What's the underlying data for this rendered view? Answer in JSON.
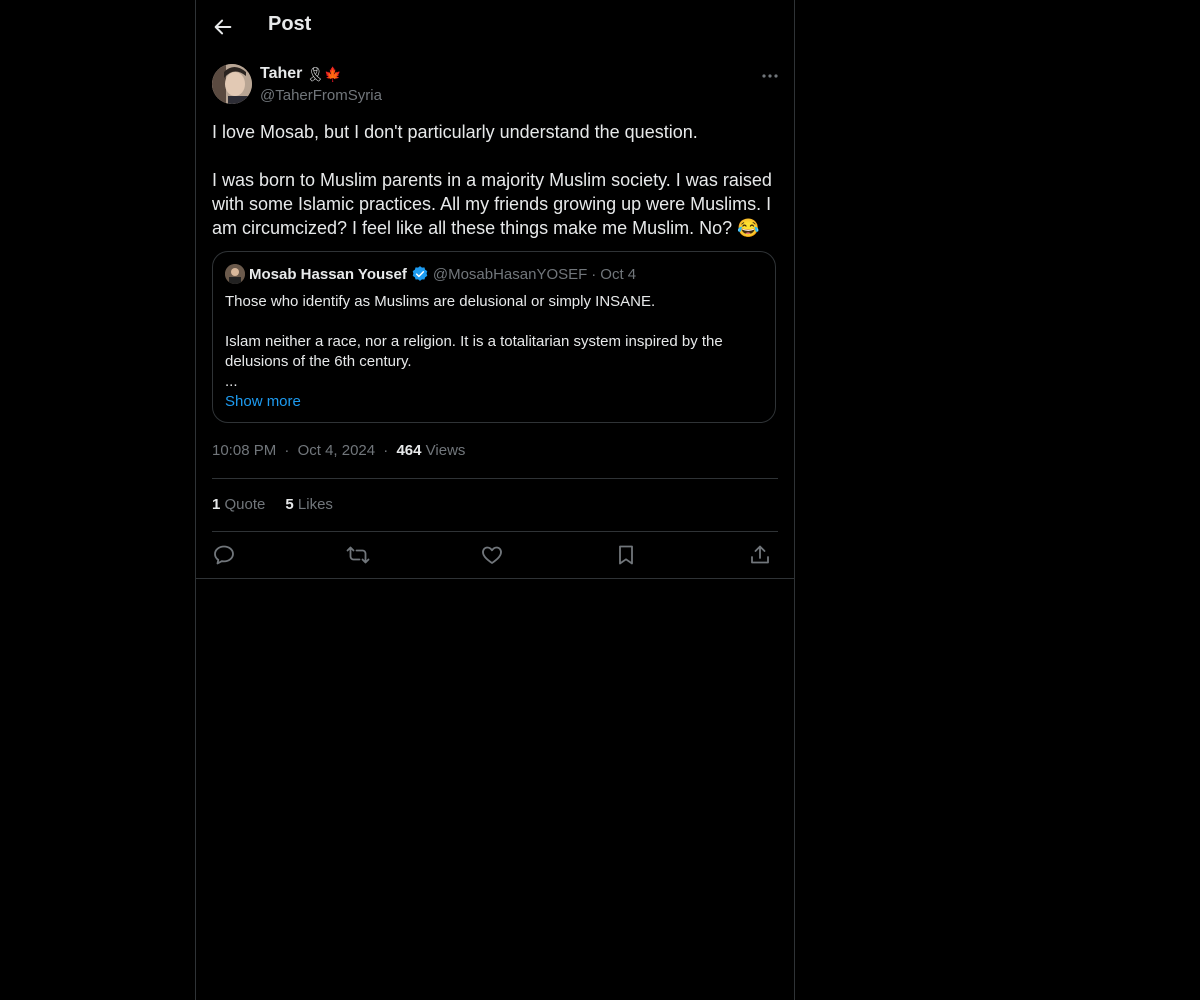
{
  "header": {
    "title": "Post"
  },
  "post": {
    "author_name": "Taher",
    "author_badges": "🎗🍁",
    "author_handle": "@TaherFromSyria",
    "text": "I love Mosab, but I don't particularly understand the question.\n\nI was born to Muslim parents in a majority Muslim society. I was raised with some Islamic practices. All my friends growing up were Muslims. I am circumcized? I feel like all these things make me Muslim. No? 😂",
    "quote": {
      "author_name": "Mosab Hassan Yousef",
      "author_handle": "@MosabHasanYOSEF",
      "separator": "·",
      "date": "Oct 4",
      "text": "Those who identify as Muslims are delusional or simply INSANE.\n\nIslam neither a race, nor a religion. It is a totalitarian system inspired by the delusions of the 6th century.\n...",
      "show_more": "Show more"
    },
    "time": "10:08 PM",
    "date": "Oct 4, 2024",
    "separator": "·",
    "views_count": "464",
    "views_label": "Views",
    "quotes_count": "1",
    "quotes_label": "Quote",
    "likes_count": "5",
    "likes_label": "Likes"
  },
  "icons": {
    "back": "arrow-left-icon",
    "more": "more-horizontal-icon",
    "reply": "reply-icon",
    "repost": "repost-icon",
    "like": "heart-icon",
    "bookmark": "bookmark-icon",
    "share": "share-icon",
    "verified": "verified-icon"
  },
  "colors": {
    "accent": "#1d9bf0",
    "muted": "#71767b",
    "text": "#e7e9ea",
    "border": "#2f3336",
    "background": "#000000"
  }
}
